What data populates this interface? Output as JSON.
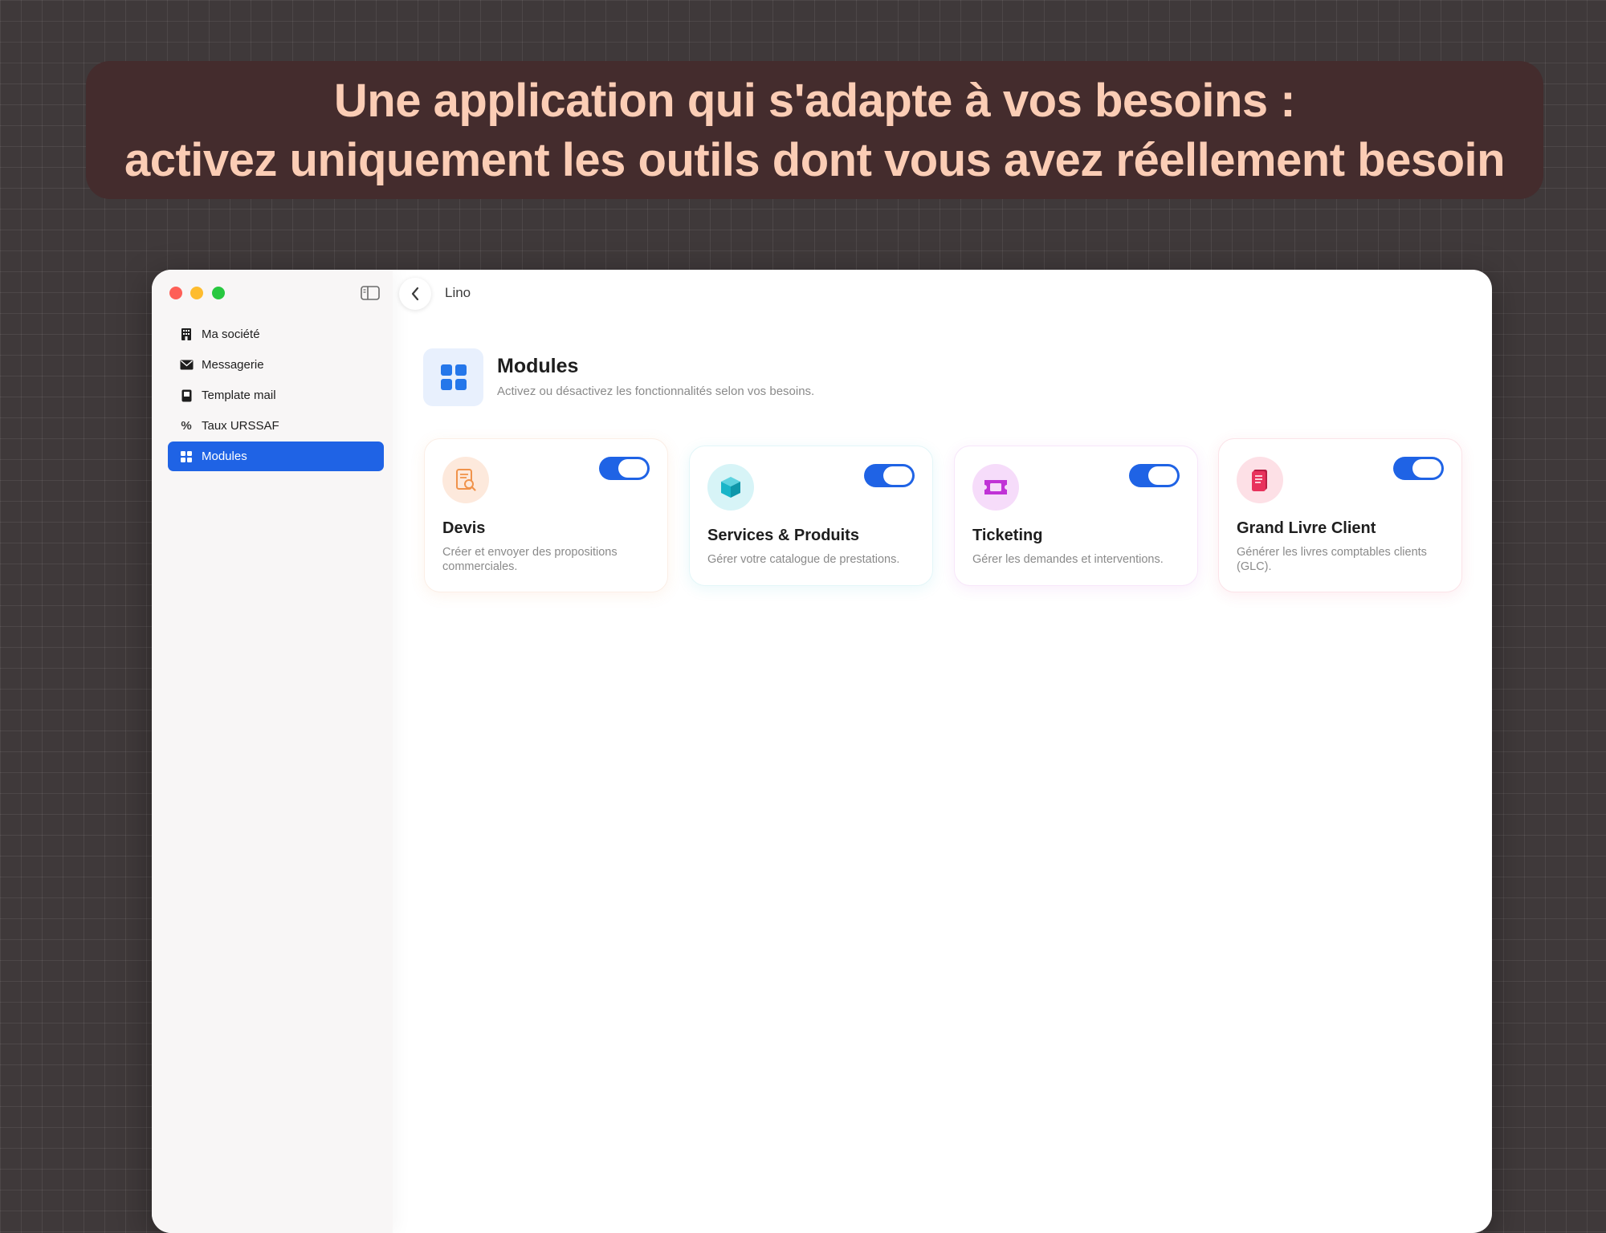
{
  "headline": {
    "line1": "Une application qui s'adapte à vos besoins :",
    "line2": "activez uniquement les outils dont vous avez réellement besoin"
  },
  "window": {
    "breadcrumb": "Lino",
    "controls": {
      "sidebar_toggle_icon": "sidebar-icon",
      "back_icon": "chevron-left-icon"
    }
  },
  "sidebar": {
    "items": [
      {
        "label": "Ma société",
        "icon": "building-icon",
        "active": false
      },
      {
        "label": "Messagerie",
        "icon": "envelope-icon",
        "active": false
      },
      {
        "label": "Template mail",
        "icon": "template-icon",
        "active": false
      },
      {
        "label": "Taux URSSAF",
        "icon": "percent-icon",
        "active": false
      },
      {
        "label": "Modules",
        "icon": "grid-icon",
        "active": true
      }
    ]
  },
  "page": {
    "title": "Modules",
    "subtitle": "Activez ou désactivez les fonctionnalités selon vos besoins.",
    "icon": "grid-icon"
  },
  "modules": [
    {
      "title": "Devis",
      "description": "Créer et envoyer des propositions commerciales.",
      "icon": "quote-search-icon",
      "accent": "#f0934b",
      "enabled": true
    },
    {
      "title": "Services & Produits",
      "description": "Gérer votre catalogue de prestations.",
      "icon": "cube-icon",
      "accent": "#19b5c8",
      "enabled": true
    },
    {
      "title": "Ticketing",
      "description": "Gérer les demandes et interventions.",
      "icon": "ticket-icon",
      "accent": "#c032d6",
      "enabled": true
    },
    {
      "title": "Grand Livre Client",
      "description": "Générer les livres comptables clients (GLC).",
      "icon": "ledger-book-icon",
      "accent": "#e8325c",
      "enabled": true
    }
  ],
  "colors": {
    "background": "#3f393a",
    "headline_bg": "#442c2d",
    "headline_text": "#fbcdb5",
    "accent": "#1f63e5"
  }
}
